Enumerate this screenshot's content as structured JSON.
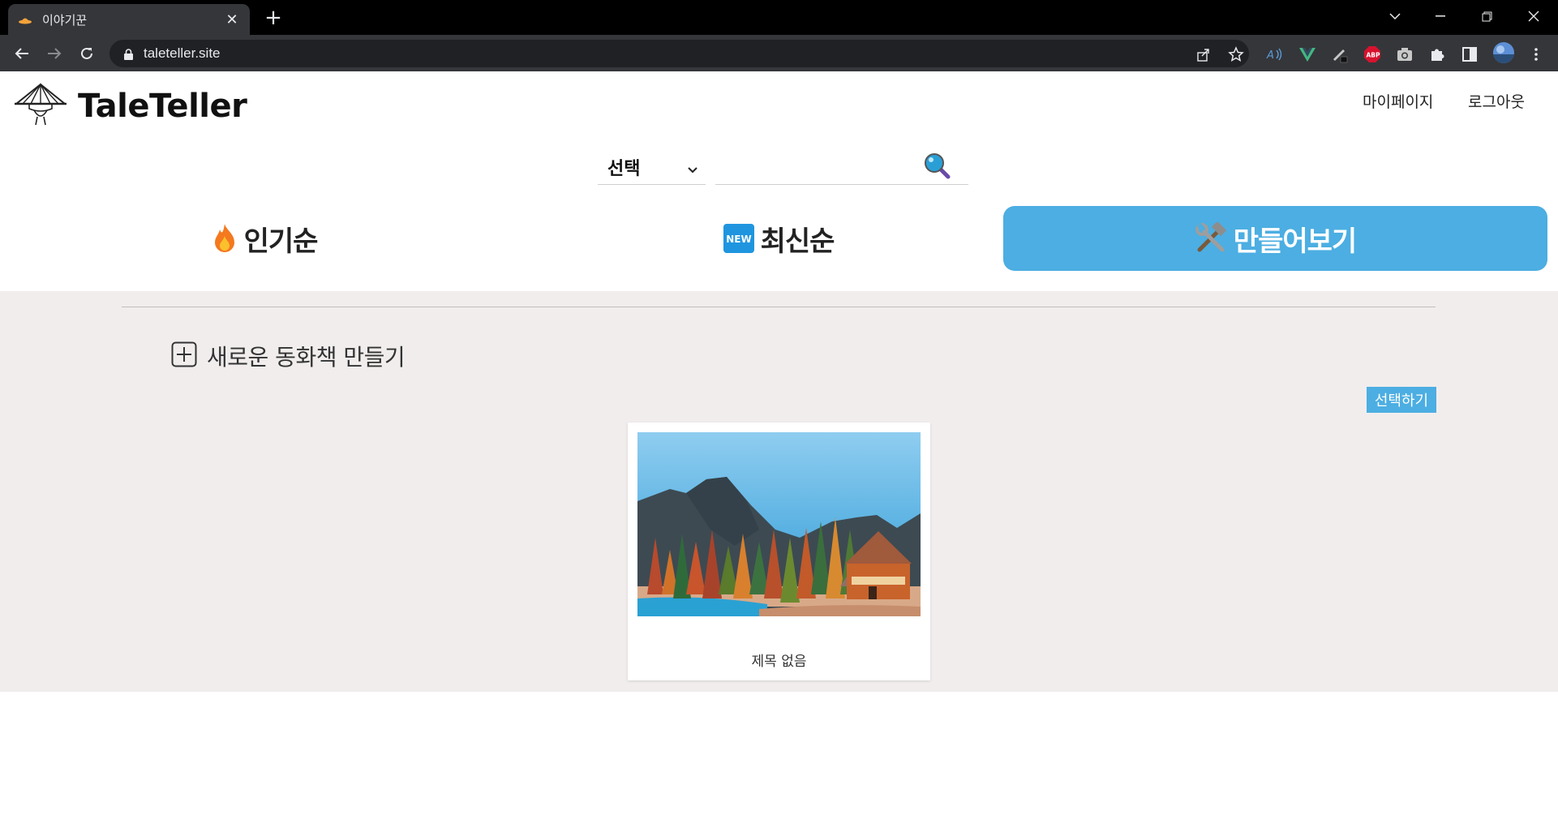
{
  "browser": {
    "tab_title": "이야기꾼",
    "url": "taleteller.site"
  },
  "header": {
    "logo_text": "TaleTeller",
    "mypage": "마이페이지",
    "logout": "로그아웃"
  },
  "search": {
    "select_value": "선택",
    "placeholder": ""
  },
  "nav_tabs": [
    {
      "label": "인기순",
      "icon": "fire-icon"
    },
    {
      "label": "최신순",
      "icon": "new-badge-icon"
    },
    {
      "label": "만들어보기",
      "icon": "hammer-wrench-icon"
    }
  ],
  "create": {
    "label": "새로운 동화책 만들기",
    "select_button": "선택하기"
  },
  "books": [
    {
      "title": "제목 없음"
    }
  ],
  "colors": {
    "accent": "#4caee2",
    "content_bg": "#f1eded"
  }
}
